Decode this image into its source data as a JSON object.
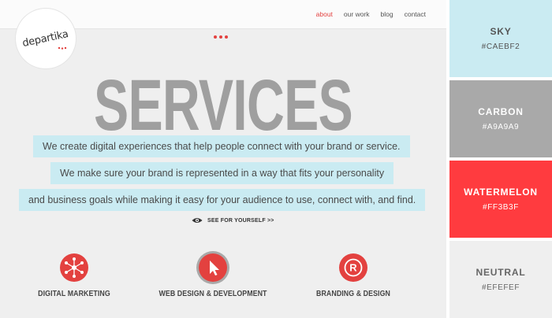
{
  "nav": {
    "items": [
      "about",
      "our work",
      "blog",
      "contact"
    ],
    "active_color": "#e3413f"
  },
  "logo": {
    "text": "departika"
  },
  "hero": {
    "title": "SERVICES",
    "lines": [
      "We create digital experiences that help people connect with your brand or service.",
      "We make sure your brand is represented in a way that fits your personality",
      "and business goals while making it easy for your audience to use, connect with, and find."
    ],
    "cta": "SEE FOR YOURSELF >>"
  },
  "services": [
    {
      "label": "DIGITAL MARKETING",
      "icon": "network-icon"
    },
    {
      "label": "WEB DESIGN & DEVELOPMENT",
      "icon": "cursor-icon"
    },
    {
      "label": "BRANDING & DESIGN",
      "icon": "registered-icon"
    }
  ],
  "palette": [
    {
      "name": "SKY",
      "hex": "#CAEBF2"
    },
    {
      "name": "CARBON",
      "hex": "#A9A9A9"
    },
    {
      "name": "WATERMELON",
      "hex": "#FF3B3F"
    },
    {
      "name": "NEUTRAL",
      "hex": "#EFEFEF"
    }
  ]
}
